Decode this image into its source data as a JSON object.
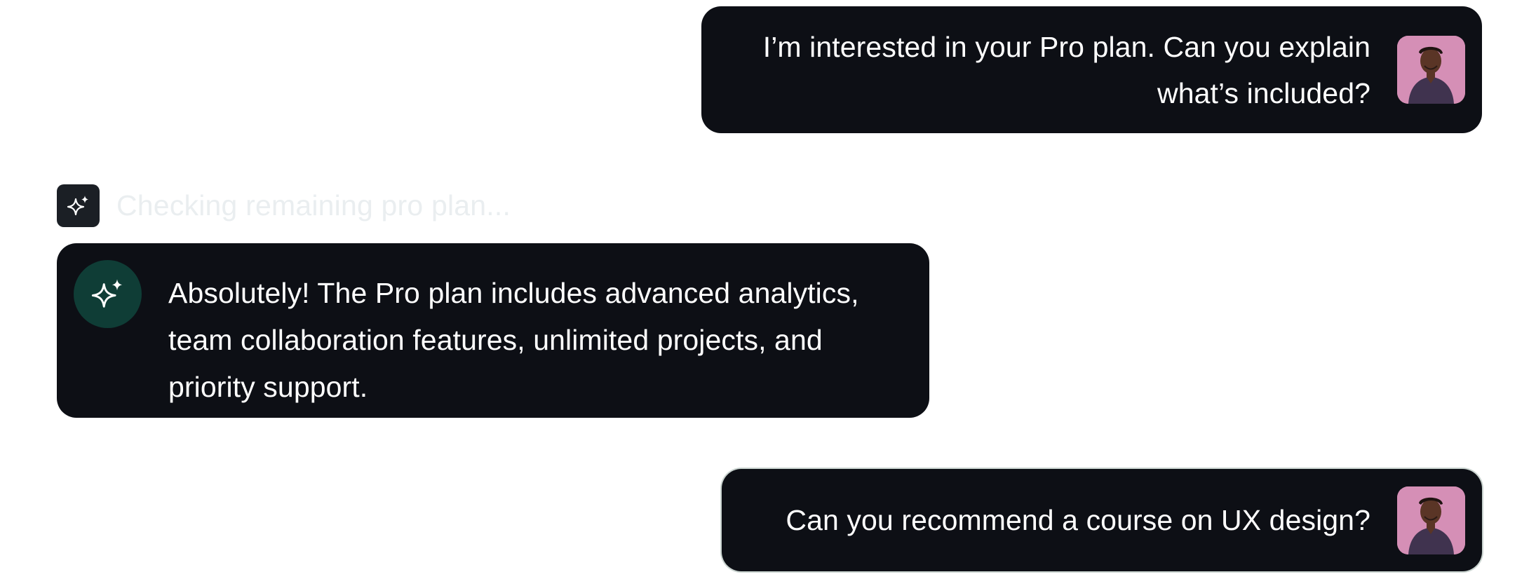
{
  "conversation": {
    "user_message_1": "I’m interested in your Pro plan. Can you explain what’s included?",
    "status": "Checking remaining pro plan...",
    "assistant_message": "Absolutely! The Pro plan includes advanced analytics, team collaboration features, unlimited projects, and priority support.",
    "user_message_2": "Can you recommend a course on UX design?"
  },
  "icons": {
    "status": "sparkle-icon",
    "assistant": "sparkle-icon",
    "user": "avatar"
  },
  "colors": {
    "bubble": "#0d0f15",
    "assistant_icon_bg": "#0f3d36",
    "status_icon_bg": "#1b1f25",
    "avatar_bg": "#d58fb6",
    "status_text": "#eaeef0"
  }
}
